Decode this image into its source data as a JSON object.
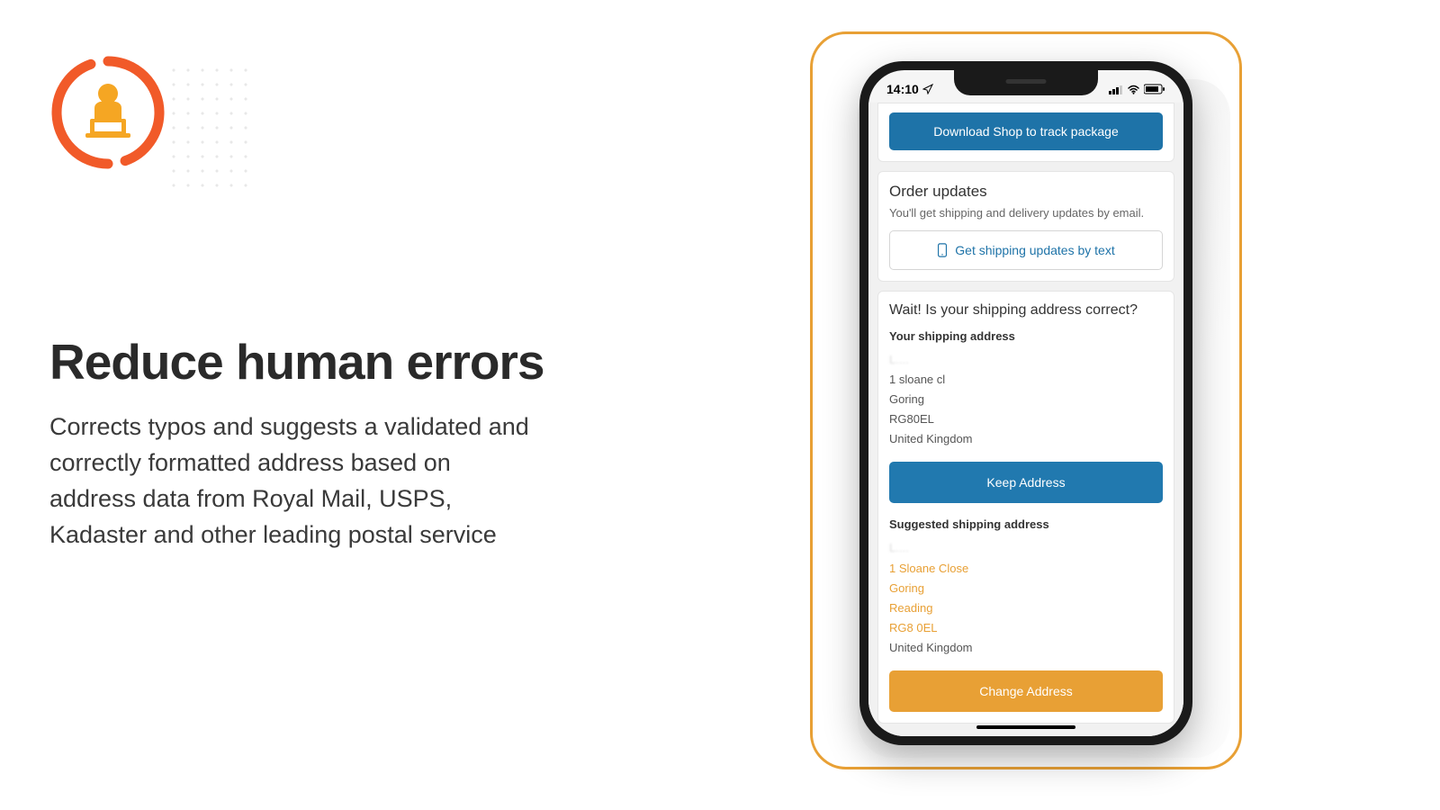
{
  "heading": "Reduce human errors",
  "description": "Corrects typos and suggests a validated and correctly formatted address based on address data from Royal Mail, USPS, Kadaster and other leading postal service",
  "phone": {
    "status_time": "14:10",
    "download_btn": "Download Shop to track package",
    "updates": {
      "title": "Order updates",
      "subtitle": "You'll get shipping and delivery updates by email.",
      "text_btn": "Get shipping updates by text"
    },
    "address_check": {
      "title": "Wait! Is your shipping address correct?",
      "your_label": "Your shipping address",
      "your_name": "L....",
      "your_line1": "1 sloane cl",
      "your_line2": "Goring",
      "your_line3": "RG80EL",
      "your_line4": "United Kingdom",
      "keep_btn": "Keep Address",
      "suggested_label": "Suggested shipping address",
      "sug_name": "L....",
      "sug_line1": "1 Sloane Close",
      "sug_line2": "Goring",
      "sug_line3": "Reading",
      "sug_line4": "RG8 0EL",
      "sug_line5": "United Kingdom",
      "change_btn": "Change Address"
    }
  }
}
